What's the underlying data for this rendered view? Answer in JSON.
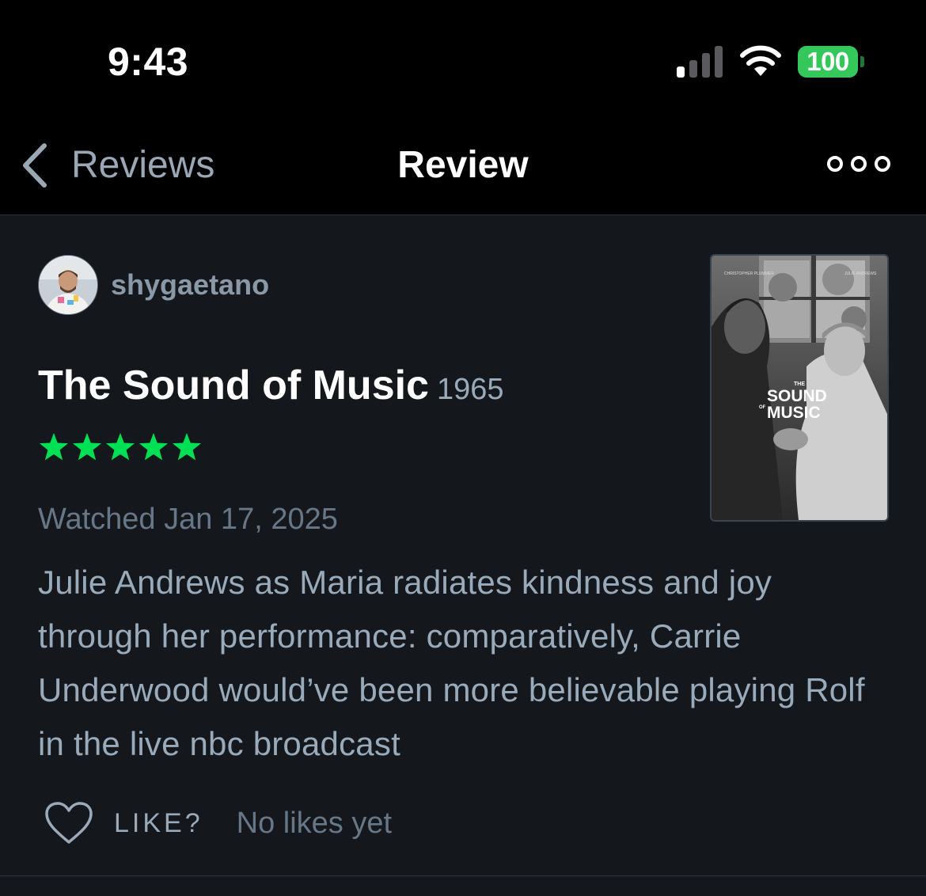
{
  "status_bar": {
    "time": "9:43",
    "battery_level": "100",
    "signal_bars_active": 1,
    "signal_bars_total": 4
  },
  "nav": {
    "back_label": "Reviews",
    "title": "Review",
    "more_icon": "more-horizontal-icon"
  },
  "review": {
    "author": "shygaetano",
    "film_title": "The Sound of Music",
    "film_year": "1965",
    "rating": 5,
    "rating_max": 5,
    "watched": "Watched Jan 17, 2025",
    "text": "Julie Andrews as Maria radiates kindness and joy through her performance: comparatively, Carrie Underwood would’ve been more believable playing Rolf in the live nbc broadcast"
  },
  "poster": {
    "credit_left": "CHRISTOPHER PLUMMER",
    "credit_right": "JULIE ANDREWS",
    "title_the": "THE",
    "title_sound": "SOUND",
    "title_of": "OF",
    "title_music": "MUSIC"
  },
  "likes": {
    "like_label": "LIKE?",
    "count_text": "No likes yet"
  },
  "colors": {
    "background": "#14181c",
    "header": "#000000",
    "star": "#00e054",
    "battery": "#34c759",
    "muted_text": "#99aabb",
    "dim_text": "#677787"
  }
}
